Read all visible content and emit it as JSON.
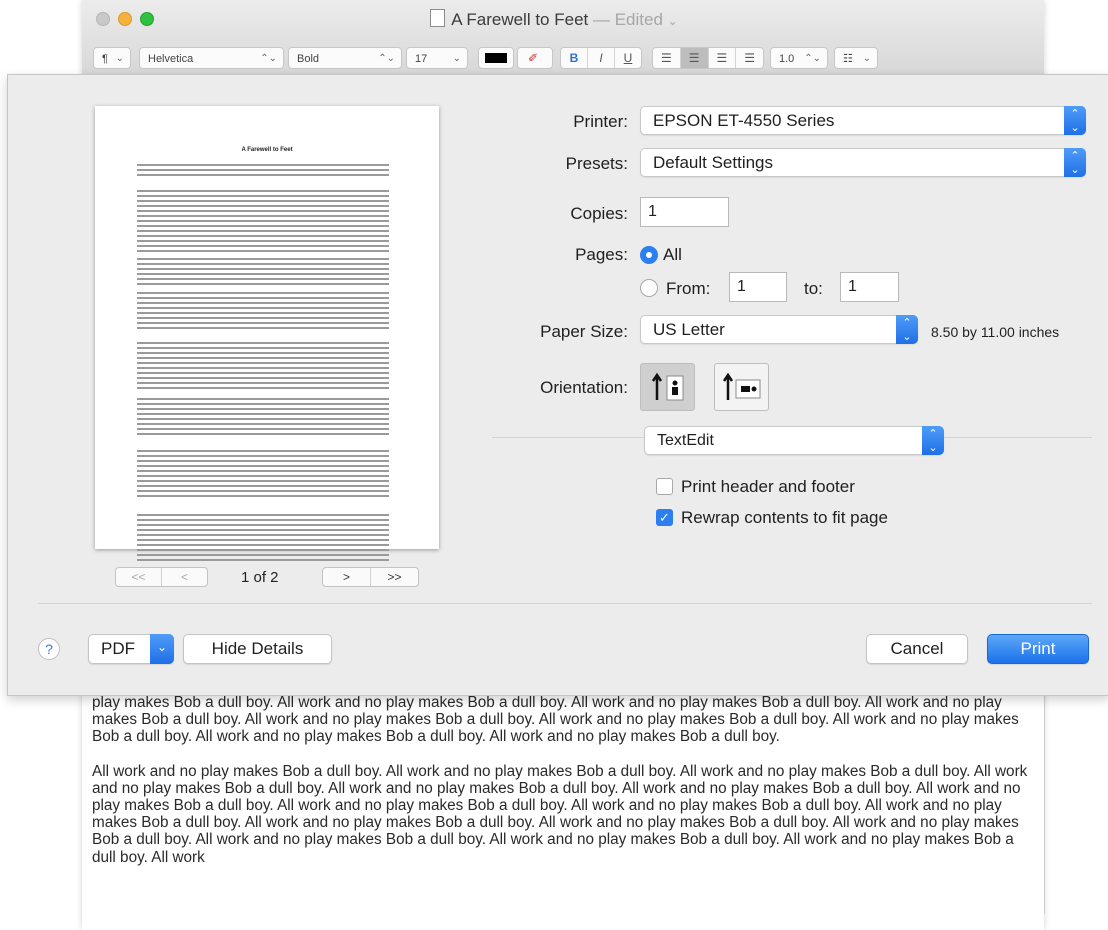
{
  "window": {
    "title": "A Farewell to Feet",
    "title_suffix": "— Edited",
    "title_chevron": "⌄"
  },
  "toolbar": {
    "paragraph_style": "¶",
    "font_family": "Helvetica",
    "font_style": "Bold",
    "font_size": "17",
    "bold": "B",
    "italic": "I",
    "underline": "U",
    "line_spacing": "1.0",
    "list_icon": "list-bullet-icon",
    "text_color": "#000000"
  },
  "print_dialog": {
    "preview": {
      "page_title": "A Farewell to Feet",
      "page_indicator": "1 of 2",
      "first_label": "<<",
      "prev_label": "<",
      "next_label": ">",
      "last_label": ">>"
    },
    "printer": {
      "label": "Printer:",
      "value": "EPSON ET-4550 Series"
    },
    "presets": {
      "label": "Presets:",
      "value": "Default Settings"
    },
    "copies": {
      "label": "Copies:",
      "value": "1"
    },
    "pages": {
      "label": "Pages:",
      "all_label": "All",
      "from_label": "From:",
      "from_value": "1",
      "to_label": "to:",
      "to_value": "1",
      "selected": "All"
    },
    "paper_size": {
      "label": "Paper Size:",
      "value": "US Letter",
      "dimensions": "8.50 by 11.00 inches"
    },
    "orientation": {
      "label": "Orientation:",
      "selected": "portrait"
    },
    "app_section": {
      "value": "TextEdit"
    },
    "options": {
      "header_footer": {
        "label": "Print header and footer",
        "checked": false
      },
      "rewrap": {
        "label": "Rewrap contents to fit page",
        "checked": true
      }
    },
    "footer": {
      "help_label": "?",
      "pdf_label": "PDF",
      "hide_details_label": "Hide Details",
      "cancel_label": "Cancel",
      "print_label": "Print"
    },
    "accent_color": "#2b7ff0"
  },
  "document": {
    "paragraphs": [
      "play makes Bob a dull boy. All work and no play makes Bob a dull boy. All work and no play makes Bob a dull boy. All work and no play makes Bob a dull boy. All work and no play makes Bob a dull boy. All work and no play makes Bob a dull boy. All work and no play makes Bob a dull boy. All work and no play makes Bob a dull boy. All work and no play makes Bob a dull boy.",
      "All work and no play makes Bob a dull boy. All work and no play makes Bob a dull boy. All work and no play makes Bob a dull boy. All work and no play makes Bob a dull boy. All work and no play makes Bob a dull boy. All work and no play makes Bob a dull boy. All work and no play makes Bob a dull boy. All work and no play makes Bob a dull boy. All work and no play makes Bob a dull boy. All work and no play makes Bob a dull boy. All work and no play makes Bob a dull boy. All work and no play makes Bob a dull boy. All work and no play makes Bob a dull boy. All work and no play makes Bob a dull boy. All work and no play makes Bob a dull boy. All work and no play makes Bob a dull boy. All work"
    ]
  }
}
